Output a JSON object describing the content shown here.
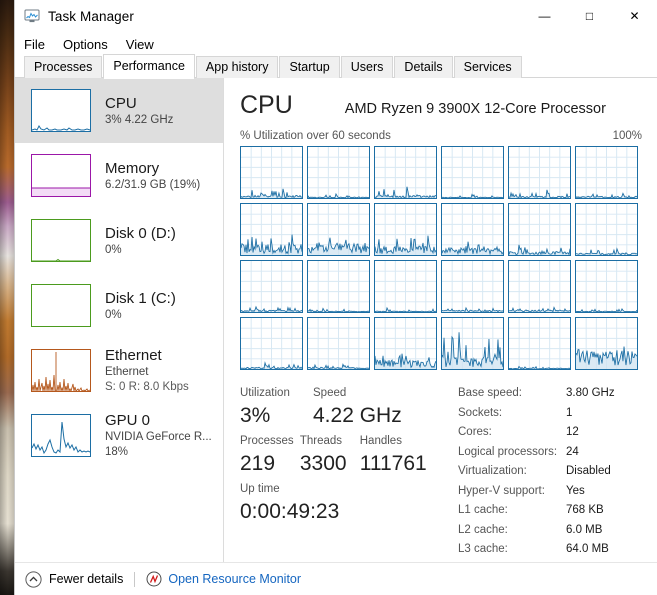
{
  "window": {
    "title": "Task Manager",
    "icon": "task-manager-icon",
    "buttons": {
      "minimize": "—",
      "maximize": "□",
      "close": "✕"
    }
  },
  "menu": {
    "items": [
      "File",
      "Options",
      "View"
    ]
  },
  "tabs": {
    "items": [
      {
        "label": "Processes",
        "active": false
      },
      {
        "label": "Performance",
        "active": true
      },
      {
        "label": "App history",
        "active": false
      },
      {
        "label": "Startup",
        "active": false
      },
      {
        "label": "Users",
        "active": false
      },
      {
        "label": "Details",
        "active": false
      },
      {
        "label": "Services",
        "active": false
      }
    ]
  },
  "sidebar": {
    "items": [
      {
        "name": "cpu",
        "title": "CPU",
        "sub1": "3%  4.22 GHz",
        "sub2": "",
        "color": "#1c6ea4",
        "selected": true
      },
      {
        "name": "memory",
        "title": "Memory",
        "sub1": "6.2/31.9 GB (19%)",
        "sub2": "",
        "color": "#9b17a8",
        "selected": false
      },
      {
        "name": "disk0",
        "title": "Disk 0 (D:)",
        "sub1": "0%",
        "sub2": "",
        "color": "#4b9b1e",
        "selected": false
      },
      {
        "name": "disk1",
        "title": "Disk 1 (C:)",
        "sub1": "0%",
        "sub2": "",
        "color": "#4b9b1e",
        "selected": false
      },
      {
        "name": "ethernet",
        "title": "Ethernet",
        "sub1": "Ethernet",
        "sub2": "S: 0 R: 8.0 Kbps",
        "color": "#b5581d",
        "selected": false
      },
      {
        "name": "gpu0",
        "title": "GPU 0",
        "sub1": "NVIDIA GeForce R...",
        "sub2": "18%",
        "color": "#1c6ea4",
        "selected": false
      }
    ]
  },
  "main": {
    "title": "CPU",
    "model": "AMD Ryzen 9 3900X 12-Core Processor",
    "graph_caption_left": "% Utilization over 60 seconds",
    "graph_caption_right": "100%",
    "graph_columns": 6,
    "graph_rows": 4,
    "logical_processor_graph_count": 24,
    "stats": {
      "utilization_label": "Utilization",
      "utilization_value": "3%",
      "speed_label": "Speed",
      "speed_value": "4.22 GHz",
      "processes_label": "Processes",
      "processes_value": "219",
      "threads_label": "Threads",
      "threads_value": "3300",
      "handles_label": "Handles",
      "handles_value": "111761",
      "uptime_label": "Up time",
      "uptime_value": "0:00:49:23"
    },
    "details": [
      {
        "label": "Base speed:",
        "value": "3.80 GHz"
      },
      {
        "label": "Sockets:",
        "value": "1"
      },
      {
        "label": "Cores:",
        "value": "12"
      },
      {
        "label": "Logical processors:",
        "value": "24"
      },
      {
        "label": "Virtualization:",
        "value": "Disabled"
      },
      {
        "label": "Hyper-V support:",
        "value": "Yes"
      },
      {
        "label": "L1 cache:",
        "value": "768 KB"
      },
      {
        "label": "L2 cache:",
        "value": "6.0 MB"
      },
      {
        "label": "L3 cache:",
        "value": "64.0 MB"
      }
    ]
  },
  "footer": {
    "fewer_details": "Fewer details",
    "fewer_details_icon": "chevron-up-circle-icon",
    "resource_monitor": "Open Resource Monitor",
    "resource_monitor_icon": "resource-monitor-icon"
  },
  "colors": {
    "cpu_line": "#1c6ea4",
    "cpu_fill": "#cfe3f0",
    "memory": "#9b17a8",
    "disk": "#4b9b1e",
    "ethernet": "#b5581d",
    "link": "#1566c0",
    "selected_row": "#dedede"
  },
  "chart_data": {
    "type": "line",
    "title": "CPU % Utilization over 60 seconds",
    "ylim": [
      0,
      100
    ],
    "series": [
      {
        "name": "CPU 0",
        "peak": 18,
        "avg": 3
      },
      {
        "name": "CPU 1",
        "peak": 8,
        "avg": 1
      },
      {
        "name": "CPU 2",
        "peak": 22,
        "avg": 3
      },
      {
        "name": "CPU 3",
        "peak": 7,
        "avg": 1
      },
      {
        "name": "CPU 4",
        "peak": 16,
        "avg": 2
      },
      {
        "name": "CPU 5",
        "peak": 9,
        "avg": 2
      },
      {
        "name": "CPU 6",
        "peak": 40,
        "avg": 12
      },
      {
        "name": "CPU 7",
        "peak": 34,
        "avg": 14
      },
      {
        "name": "CPU 8",
        "peak": 38,
        "avg": 10
      },
      {
        "name": "CPU 9",
        "peak": 26,
        "avg": 8
      },
      {
        "name": "CPU 10",
        "peak": 20,
        "avg": 4
      },
      {
        "name": "CPU 11",
        "peak": 12,
        "avg": 2
      },
      {
        "name": "CPU 12",
        "peak": 10,
        "avg": 2
      },
      {
        "name": "CPU 13",
        "peak": 7,
        "avg": 1
      },
      {
        "name": "CPU 14",
        "peak": 8,
        "avg": 1
      },
      {
        "name": "CPU 15",
        "peak": 8,
        "avg": 2
      },
      {
        "name": "CPU 16",
        "peak": 9,
        "avg": 2
      },
      {
        "name": "CPU 17",
        "peak": 6,
        "avg": 1
      },
      {
        "name": "CPU 18",
        "peak": 12,
        "avg": 2
      },
      {
        "name": "CPU 19",
        "peak": 9,
        "avg": 2
      },
      {
        "name": "CPU 20",
        "peak": 30,
        "avg": 10
      },
      {
        "name": "CPU 21",
        "peak": 72,
        "avg": 14
      },
      {
        "name": "CPU 22",
        "peak": 5,
        "avg": 1
      },
      {
        "name": "CPU 23",
        "peak": 44,
        "avg": 22
      }
    ]
  }
}
